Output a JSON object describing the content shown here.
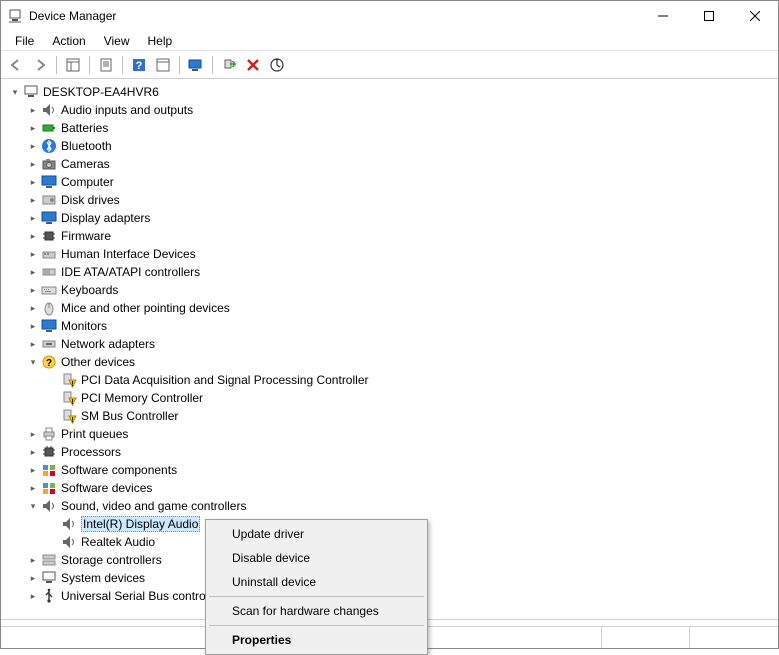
{
  "window": {
    "title": "Device Manager"
  },
  "menu": {
    "file": "File",
    "action": "Action",
    "view": "View",
    "help": "Help"
  },
  "tree": {
    "root": "DESKTOP-EA4HVR6",
    "audio_io": "Audio inputs and outputs",
    "batteries": "Batteries",
    "bluetooth": "Bluetooth",
    "cameras": "Cameras",
    "computer": "Computer",
    "disk_drives": "Disk drives",
    "display_adapters": "Display adapters",
    "firmware": "Firmware",
    "hid": "Human Interface Devices",
    "ide": "IDE ATA/ATAPI controllers",
    "keyboards": "Keyboards",
    "mice": "Mice and other pointing devices",
    "monitors": "Monitors",
    "network": "Network adapters",
    "other": "Other devices",
    "other_1": "PCI Data Acquisition and Signal Processing Controller",
    "other_2": "PCI Memory Controller",
    "other_3": "SM Bus Controller",
    "print_queues": "Print queues",
    "processors": "Processors",
    "sw_components": "Software components",
    "sw_devices": "Software devices",
    "sound": "Sound, video and game controllers",
    "sound_1": "Intel(R) Display Audio",
    "sound_2": "Realtek Audio",
    "storage": "Storage controllers",
    "system": "System devices",
    "usb": "Universal Serial Bus controllers"
  },
  "context_menu": {
    "update": "Update driver",
    "disable": "Disable device",
    "uninstall": "Uninstall device",
    "scan": "Scan for hardware changes",
    "properties": "Properties"
  }
}
